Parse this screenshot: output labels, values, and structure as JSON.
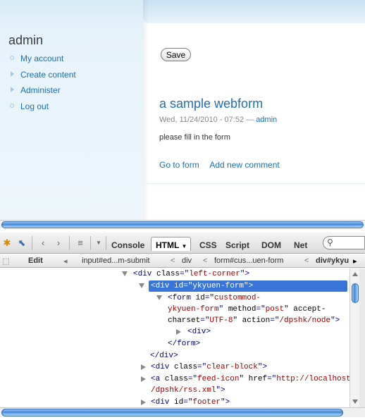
{
  "sidebar": {
    "title": "admin",
    "menu": [
      {
        "label": "My account",
        "bullet": "leaf"
      },
      {
        "label": "Create content",
        "bullet": "collapsed"
      },
      {
        "label": "Administer",
        "bullet": "collapsed"
      },
      {
        "label": "Log out",
        "bullet": "leaf"
      }
    ]
  },
  "content": {
    "save_label": "Save",
    "node_title": "a sample webform",
    "meta_prefix": "Wed, 11/24/2010 - 07:52 — ",
    "meta_author": "admin",
    "body": "please fill in the form",
    "links": [
      "Go to form",
      "Add new comment"
    ]
  },
  "firebug": {
    "tabs": [
      "Console",
      "HTML",
      "CSS",
      "Script",
      "DOM",
      "Net"
    ],
    "active_tab": "HTML",
    "path_edit_label": "Edit",
    "path": [
      "input#ed...m-submit",
      "div",
      "form#cus...uen-form",
      "div#ykyu"
    ],
    "tree": [
      {
        "tag_open": "<div ",
        "attr": "class",
        "eq": "=\"",
        "value": "left-corner",
        "tag_close": "\">"
      },
      {
        "tag_open": "<div ",
        "attr": "id",
        "eq": "=\"",
        "value": "ykyuen-form",
        "tag_close": "\">"
      },
      {
        "line1_tag": "<form ",
        "line1_attr": "id",
        "line1_eq": "=\"",
        "line1_value": "custommod-",
        "line2_value": "ykyuen-form",
        "line2_attr1": " method",
        "line2_eq1": "=\"",
        "line2_val1": "post",
        "line2_q1": "\"",
        "line2_attr2": " accept-",
        "line3_attr": "charset",
        "line3_eq": "=\"",
        "line3_value": "UTF-8",
        "line3_attr2": "\" action",
        "line3_eq2": "=\"",
        "line3_value2": "/dpshk/node",
        "line3_close": "\">"
      },
      {
        "text": "<div>"
      },
      {
        "text": "</form>"
      },
      {
        "text": "</div>"
      },
      {
        "tag_open": "<div ",
        "attr": "class",
        "eq": "=\"",
        "value": "clear-block",
        "tag_close": "\">"
      },
      {
        "tag_open": "<a ",
        "attr": "class",
        "eq": "=\"",
        "value": "feed-icon",
        "mid": "\" href",
        "eq2": "=\"",
        "value2": "http://localhost",
        "line2": "/dpshk/rss.xml",
        "line2_close": "\">"
      },
      {
        "tag_open": "<div ",
        "attr": "id",
        "eq": "=\"",
        "value": "footer",
        "tag_close": "\">"
      }
    ]
  },
  "colors": {
    "link": "#1d6fb0",
    "selection": "#3875d7",
    "tag": "#000080",
    "attr_value": "#a00000"
  }
}
